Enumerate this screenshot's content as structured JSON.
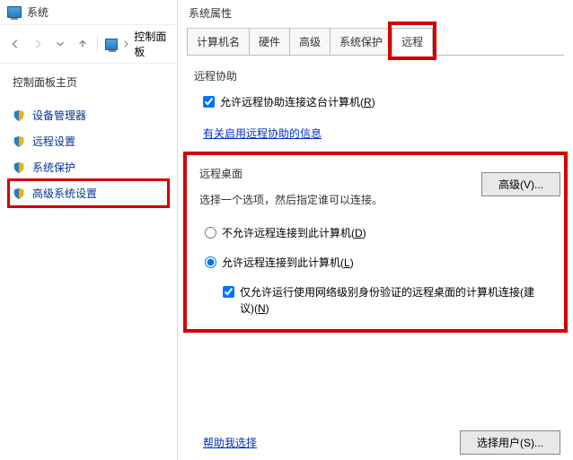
{
  "window": {
    "title": "系统"
  },
  "breadcrumb": {
    "item": "控制面板"
  },
  "sidebar": {
    "title": "控制面板主页",
    "items": [
      {
        "label": "设备管理器"
      },
      {
        "label": "远程设置"
      },
      {
        "label": "系统保护"
      },
      {
        "label": "高级系统设置"
      }
    ]
  },
  "dialog": {
    "title": "系统属性"
  },
  "tabs": [
    {
      "label": "计算机名"
    },
    {
      "label": "硬件"
    },
    {
      "label": "高级"
    },
    {
      "label": "系统保护"
    },
    {
      "label": "远程"
    }
  ],
  "remote_assist": {
    "group_label": "远程协助",
    "checkbox_label": "允许远程协助连接这台计算机(",
    "checkbox_key": "R",
    "checkbox_suffix": ")",
    "info_link": "有关启用远程协助的信息",
    "advanced_btn": "高级(V)..."
  },
  "remote_desktop": {
    "group_label": "远程桌面",
    "desc": "选择一个选项，然后指定谁可以连接。",
    "radio_disallow": "不允许远程连接到此计算机(",
    "radio_disallow_key": "D",
    "radio_allow": "允许远程连接到此计算机(",
    "radio_allow_key": "L",
    "radio_suffix": ")",
    "nla_check": "仅允许运行使用网络级别身份验证的远程桌面的计算机连接(建议)(",
    "nla_key": "N",
    "nla_suffix": ")"
  },
  "footer": {
    "help_link": "帮助我选择",
    "select_users_btn": "选择用户(S)..."
  }
}
